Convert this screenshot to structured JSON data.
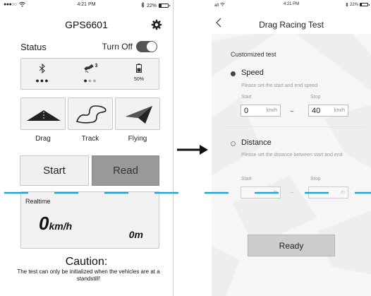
{
  "left_phone": {
    "status_bar": {
      "signal": "●●●○○",
      "wifi_icon": "wifi-icon",
      "time": "4:21 PM",
      "bluetooth_icon": "bluetooth-icon",
      "battery": "22%",
      "battery_level": 0.22
    },
    "title": "GPS6601",
    "settings_icon": "gear-icon",
    "status": {
      "label": "Status",
      "toggle_label": "Turn Off",
      "toggle_on": true
    },
    "info": {
      "bluetooth_dots": "●●●",
      "satellite_count": "3",
      "satellite_dots_on": "●",
      "satellite_dots_off": "●●",
      "battery_pct": "50%",
      "battery_level": 0.5
    },
    "modes": [
      {
        "label": "Drag",
        "icon": "drag-strip-icon"
      },
      {
        "label": "Track",
        "icon": "race-track-icon"
      },
      {
        "label": "Flying",
        "icon": "paper-plane-icon"
      }
    ],
    "buttons": {
      "start": "Start",
      "read": "Read"
    },
    "realtime": {
      "label": "Realtime",
      "speed": "0",
      "speed_unit": "km/h",
      "distance": "0m"
    },
    "caution": {
      "title": "Caution:",
      "text": "The test can only be initialized when the vehicles are at a standstill!"
    }
  },
  "arrow_icon": "right-arrow-icon",
  "right_phone": {
    "status_bar": {
      "signal": "all",
      "time": "4:21 PM",
      "battery": "22%",
      "battery_level": 0.22
    },
    "back_icon": "chevron-left-icon",
    "title": "Drag Racing Test",
    "subtitle": "Customized test",
    "speed_option": {
      "label": "Speed",
      "selected": true,
      "hint": "Please set the start and end speed",
      "start_label": "Start",
      "stop_label": "Stop",
      "start_value": "0",
      "stop_value": "40",
      "unit": "km/h",
      "separator": "~"
    },
    "distance_option": {
      "label": "Distance",
      "selected": false,
      "hint": "Please set the distance between start and end",
      "start_label": "Start",
      "stop_label": "Stop",
      "unit": "m",
      "separator": "~"
    },
    "ready_button": "Ready"
  },
  "colors": {
    "accent_dash": "#1aa6d9",
    "read_button": "#999999",
    "toggle": "#555555"
  }
}
